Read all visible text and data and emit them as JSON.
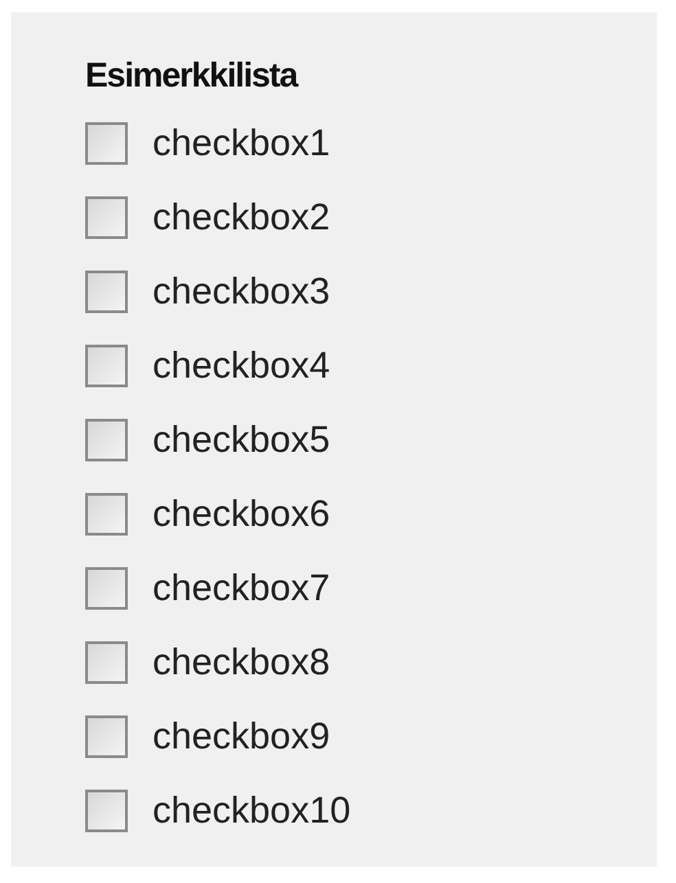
{
  "group": {
    "title": "Esimerkkilista",
    "items": [
      {
        "label": "checkbox1",
        "checked": false
      },
      {
        "label": "checkbox2",
        "checked": false
      },
      {
        "label": "checkbox3",
        "checked": false
      },
      {
        "label": "checkbox4",
        "checked": false
      },
      {
        "label": "checkbox5",
        "checked": false
      },
      {
        "label": "checkbox6",
        "checked": false
      },
      {
        "label": "checkbox7",
        "checked": false
      },
      {
        "label": "checkbox8",
        "checked": false
      },
      {
        "label": "checkbox9",
        "checked": false
      },
      {
        "label": "checkbox10",
        "checked": false
      }
    ]
  }
}
